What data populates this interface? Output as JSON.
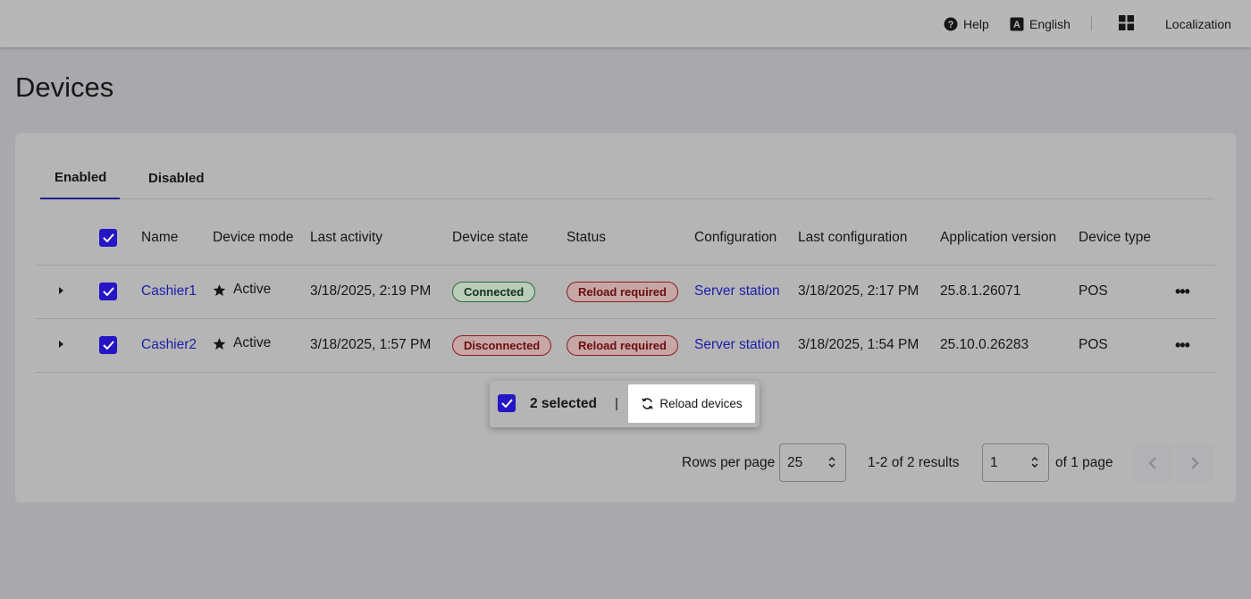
{
  "header": {
    "help_label": "Help",
    "language_label": "English",
    "localization_label": "Localization"
  },
  "page": {
    "title": "Devices"
  },
  "tabs": [
    {
      "label": "Enabled",
      "active": true
    },
    {
      "label": "Disabled",
      "active": false
    }
  ],
  "table": {
    "columns": [
      "Name",
      "Device mode",
      "Last activity",
      "Device state",
      "Status",
      "Configuration",
      "Last configuration",
      "Application version",
      "Device type"
    ],
    "rows": [
      {
        "name": "Cashier1",
        "mode": "Active",
        "last_activity": "3/18/2025, 2:19 PM",
        "state": "Connected",
        "status": "Reload required",
        "configuration": "Server station",
        "last_configuration": "3/18/2025, 2:17 PM",
        "app_version": "25.8.1.26071",
        "device_type": "POS"
      },
      {
        "name": "Cashier2",
        "mode": "Active",
        "last_activity": "3/18/2025, 1:57 PM",
        "state": "Disconnected",
        "status": "Reload required",
        "configuration": "Server station",
        "last_configuration": "3/18/2025, 1:54 PM",
        "app_version": "25.10.0.26283",
        "device_type": "POS"
      }
    ]
  },
  "selection": {
    "count_label": "2 selected",
    "divider": "|",
    "reload_label": "Reload devices"
  },
  "pagination": {
    "rows_per_page_label": "Rows per page",
    "rows_per_page_value": "25",
    "results_label": "1-2 of 2 results",
    "page_value": "1",
    "of_pages_label": "of 1 page"
  },
  "colors": {
    "accent": "#2416c4",
    "link": "#1b1fa8",
    "connected": "#2b6a3a",
    "disconnected": "#8a1f1f"
  }
}
